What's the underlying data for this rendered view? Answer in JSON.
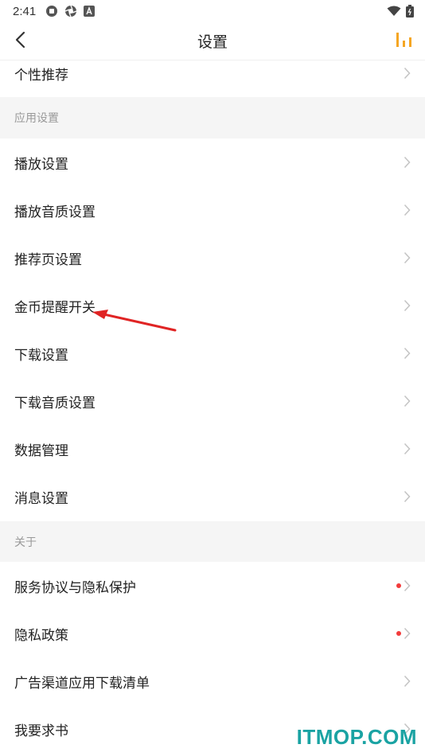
{
  "status_bar": {
    "time": "2:41",
    "left_icons": [
      "android-alert-icon",
      "aperture-icon",
      "a-box-icon"
    ],
    "right_icons": [
      "wifi-icon",
      "battery-icon"
    ]
  },
  "header": {
    "title": "设置",
    "back_icon": "chevron-left-icon",
    "right_icon": "equalizer-icon",
    "accent_color": "#f5a623"
  },
  "rows_top": [
    {
      "label": "个性推荐"
    }
  ],
  "sections": [
    {
      "title": "应用设置",
      "items": [
        {
          "label": "播放设置"
        },
        {
          "label": "播放音质设置"
        },
        {
          "label": "推荐页设置"
        },
        {
          "label": "金币提醒开关"
        },
        {
          "label": "下载设置"
        },
        {
          "label": "下载音质设置"
        },
        {
          "label": "数据管理"
        },
        {
          "label": "消息设置"
        }
      ]
    },
    {
      "title": "关于",
      "items": [
        {
          "label": "服务协议与隐私保护",
          "badge": "red-dot"
        },
        {
          "label": "隐私政策",
          "badge": "red-dot"
        },
        {
          "label": "广告渠道应用下载清单"
        },
        {
          "label": "我要求书"
        }
      ]
    }
  ],
  "annotation": {
    "arrow_color": "#e02424"
  },
  "watermark": "ITMOP.COM"
}
